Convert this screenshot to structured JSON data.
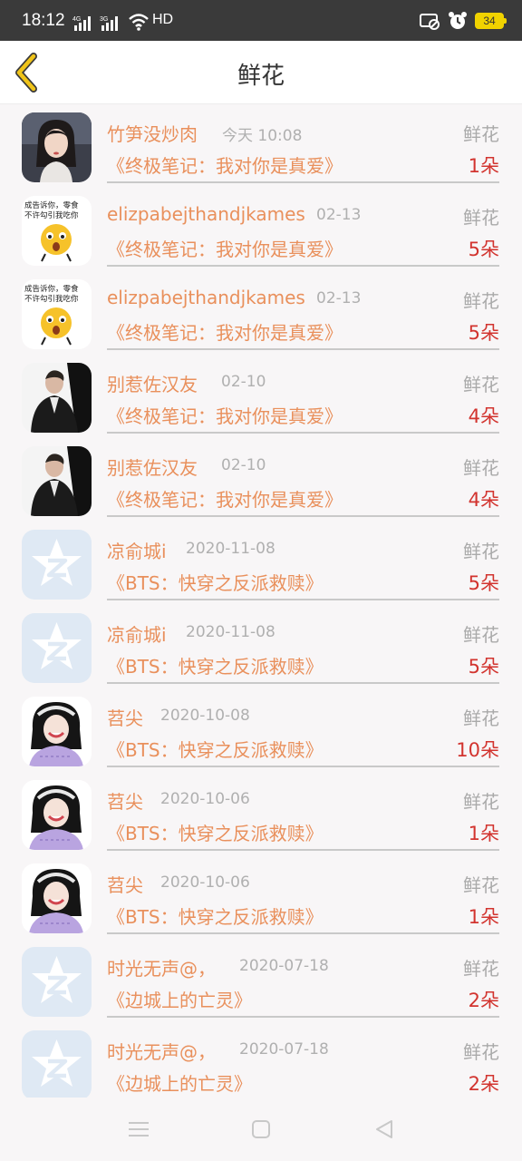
{
  "status_bar": {
    "time": "18:12",
    "network_label": "HD",
    "battery": "34",
    "icons": [
      "4g-signal-icon",
      "3g-signal-icon",
      "wifi-icon",
      "cast-icon",
      "alarm-icon",
      "battery-icon"
    ]
  },
  "header": {
    "title": "鲜花",
    "back_icon": "chevron-left-icon"
  },
  "colors": {
    "accent_orange": "#e9905c",
    "count_red": "#d2342f",
    "back_yellow": "#f0c419",
    "placeholder_avatar": "#dfe9f4"
  },
  "records": [
    {
      "user": "竹笋没炒肉",
      "date": "今天 10:08",
      "gift": "鲜花",
      "book": "《终极笔记：我对你是真爱》",
      "count": "1朵",
      "avatar": "girl-portrait"
    },
    {
      "user": "elizpabejthandjkames",
      "date": "02-13",
      "gift": "鲜花",
      "book": "《终极笔记：我对你是真爱》",
      "count": "5朵",
      "avatar": "emoji-meme"
    },
    {
      "user": "elizpabejthandjkames",
      "date": "02-13",
      "gift": "鲜花",
      "book": "《终极笔记：我对你是真爱》",
      "count": "5朵",
      "avatar": "emoji-meme"
    },
    {
      "user": "别惹佐汉友",
      "date": "02-10",
      "gift": "鲜花",
      "book": "《终极笔记：我对你是真爱》",
      "count": "4朵",
      "avatar": "man-in-suit"
    },
    {
      "user": "别惹佐汉友",
      "date": "02-10",
      "gift": "鲜花",
      "book": "《终极笔记：我对你是真爱》",
      "count": "4朵",
      "avatar": "man-in-suit"
    },
    {
      "user": "凉俞城i",
      "date": "2020-11-08",
      "gift": "鲜花",
      "book": "《BTS：快穿之反派救赎》",
      "count": "5朵",
      "avatar": "default-star"
    },
    {
      "user": "凉俞城i",
      "date": "2020-11-08",
      "gift": "鲜花",
      "book": "《BTS：快穿之反派救赎》",
      "count": "5朵",
      "avatar": "default-star"
    },
    {
      "user": "苕尖",
      "date": "2020-10-08",
      "gift": "鲜花",
      "book": "《BTS：快穿之反派救赎》",
      "count": "10朵",
      "avatar": "smiling-girl"
    },
    {
      "user": "苕尖",
      "date": "2020-10-06",
      "gift": "鲜花",
      "book": "《BTS：快穿之反派救赎》",
      "count": "1朵",
      "avatar": "smiling-girl"
    },
    {
      "user": "苕尖",
      "date": "2020-10-06",
      "gift": "鲜花",
      "book": "《BTS：快穿之反派救赎》",
      "count": "1朵",
      "avatar": "smiling-girl"
    },
    {
      "user": "时光无声@，",
      "date": "2020-07-18",
      "gift": "鲜花",
      "book": "《边城上的亡灵》",
      "count": "2朵",
      "avatar": "default-star"
    },
    {
      "user": "时光无声@，",
      "date": "2020-07-18",
      "gift": "鲜花",
      "book": "《边城上的亡灵》",
      "count": "2朵",
      "avatar": "default-star"
    }
  ],
  "nav_bar": {
    "icons": [
      "menu-icon",
      "home-square-icon",
      "back-triangle-icon"
    ]
  }
}
